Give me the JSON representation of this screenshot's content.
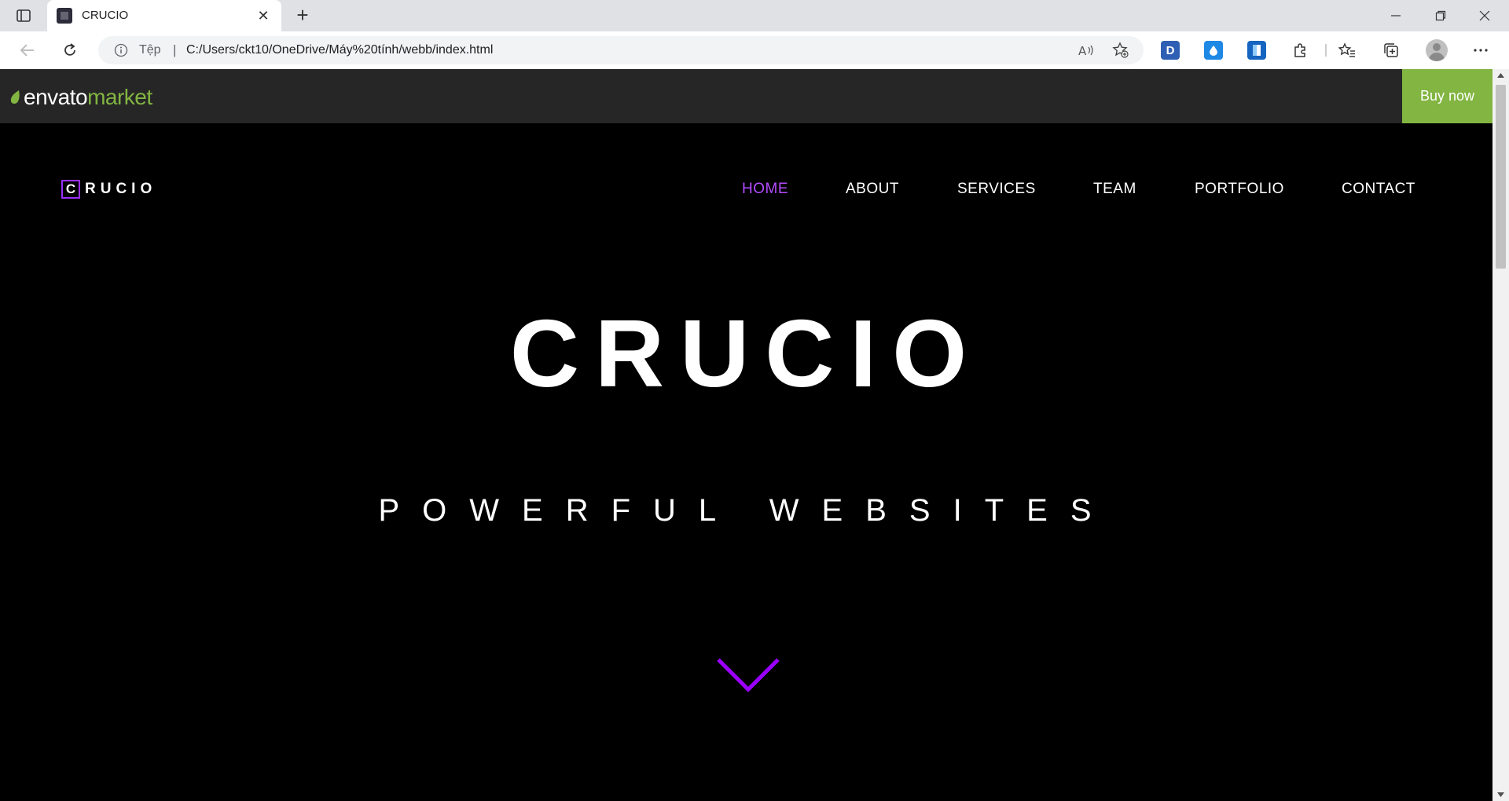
{
  "browser": {
    "tab_title": "CRUCIO",
    "address_scheme": "Tệp",
    "address_separator": "|",
    "url": "C:/Users/ckt10/OneDrive/Máy%20tính/webb/index.html",
    "extension_d_label": "D"
  },
  "envato_bar": {
    "logo_word_1": "envato",
    "logo_word_2": "market",
    "buy_now_label": "Buy now",
    "accent_color": "#82b541"
  },
  "site": {
    "logo_letter": "C",
    "logo_rest": "RUCIO",
    "nav": [
      {
        "label": "HOME",
        "active": true
      },
      {
        "label": "ABOUT",
        "active": false
      },
      {
        "label": "SERVICES",
        "active": false
      },
      {
        "label": "TEAM",
        "active": false
      },
      {
        "label": "PORTFOLIO",
        "active": false
      },
      {
        "label": "CONTACT",
        "active": false
      }
    ],
    "hero_title": "CRUCIO",
    "hero_subtitle": "POWERFUL WEBSITES",
    "accent_color": "#9b30ff",
    "scroll_icon": "chevron-down-icon"
  }
}
